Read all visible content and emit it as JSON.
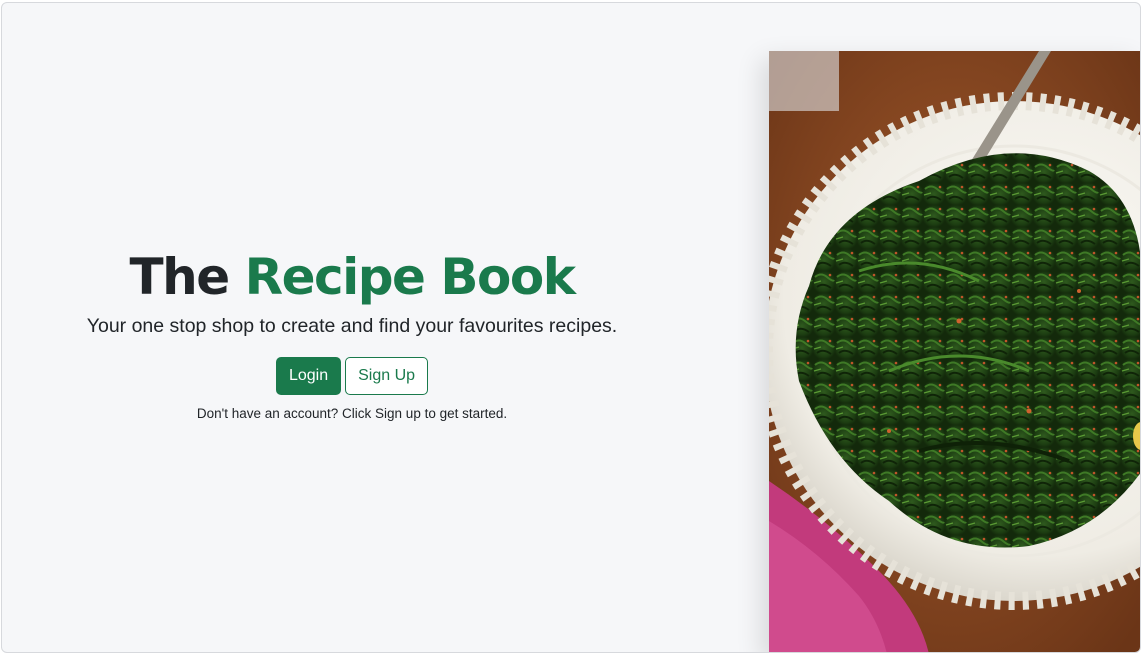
{
  "hero": {
    "title_prefix": "The",
    "title_accent": "Recipe Book",
    "subtitle": "Your one stop shop to create and find your favourites recipes.",
    "login_label": "Login",
    "signup_label": "Sign Up",
    "hint": "Don't have an account? Click Sign up to get started."
  },
  "image": {
    "alt": "Plate of sautéed greens with a fork"
  },
  "colors": {
    "accent": "#1a7a4c",
    "text": "#212529",
    "background": "#f6f7f9"
  }
}
